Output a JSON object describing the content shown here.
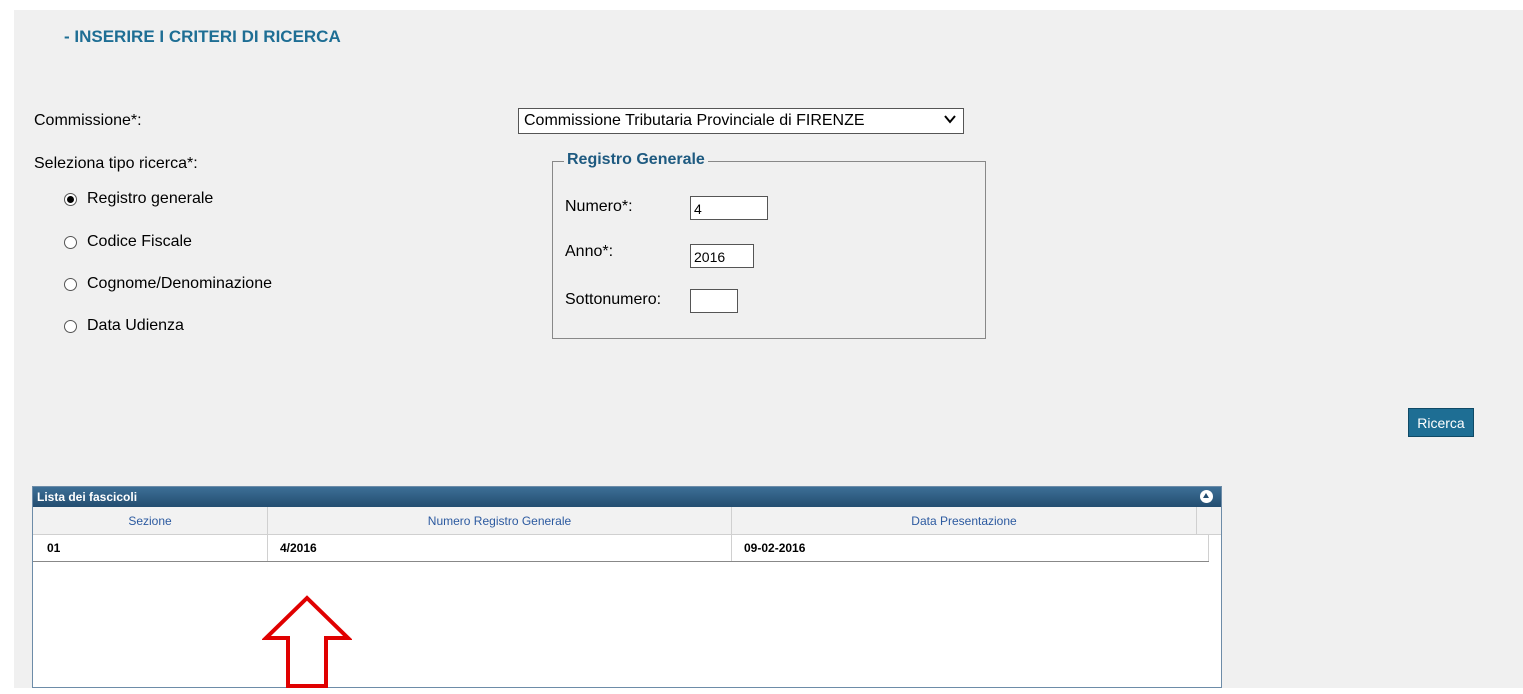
{
  "form": {
    "title": "- INSERIRE I CRITERI DI RICERCA",
    "commissione_label": "Commissione*:",
    "commissione_value": "Commissione Tributaria Provinciale di FIRENZE",
    "tipo_ricerca_label": "Seleziona tipo ricerca*:",
    "tipo_ricerca_options": [
      {
        "label": "Registro generale",
        "selected": true
      },
      {
        "label": "Codice Fiscale",
        "selected": false
      },
      {
        "label": "Cognome/Denominazione",
        "selected": false
      },
      {
        "label": "Data Udienza",
        "selected": false
      }
    ],
    "registro": {
      "legend": "Registro Generale",
      "numero_label": "Numero*:",
      "numero_value": "4",
      "anno_label": "Anno*:",
      "anno_value": "2016",
      "sottonumero_label": "Sottonumero:",
      "sottonumero_value": ""
    },
    "search_button": "Ricerca"
  },
  "grid": {
    "title": "Lista dei fascicoli",
    "columns": [
      "Sezione",
      "Numero Registro Generale",
      "Data Presentazione"
    ],
    "rows": [
      [
        "01",
        "4/2016",
        "09-02-2016"
      ]
    ]
  },
  "colors": {
    "accent": "#1e6e94",
    "panel_bg": "#f0f0f0",
    "annotation_arrow": "#e00000"
  }
}
